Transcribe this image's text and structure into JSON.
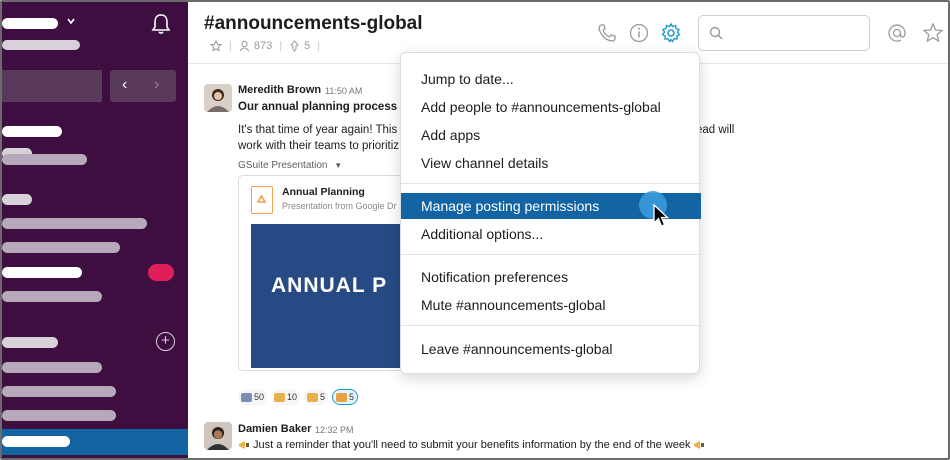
{
  "channel": {
    "name": "#announcements-global",
    "member_count": "873",
    "pinned_count": "5"
  },
  "search": {
    "placeholder": ""
  },
  "dropdown": {
    "items": [
      {
        "label": "Jump to date..."
      },
      {
        "label": "Add people to #announcements-global"
      },
      {
        "label": "Add apps"
      },
      {
        "label": "View channel details"
      },
      {
        "label": "Manage posting permissions",
        "highlighted": true
      },
      {
        "label": "Additional options..."
      },
      {
        "label": "Notification preferences"
      },
      {
        "label": "Mute #announcements-global"
      },
      {
        "label": "Leave #announcements-global"
      }
    ]
  },
  "messages": [
    {
      "author": "Meredith Brown",
      "time": "11:50 AM",
      "line1": "Our annual planning process will",
      "line2": "It's that time of year again! This w",
      "line2_right": "ead will",
      "line3": "work with their teams to prioritiz",
      "attachment": {
        "source_label": "GSuite Presentation",
        "title": "Annual Planning",
        "subtitle": "Presentation from Google Dr",
        "preview_text": "ANNUAL P"
      },
      "reactions": [
        {
          "count": "50",
          "color": "#7a8fb5",
          "selected": false
        },
        {
          "count": "10",
          "color": "#e8b04a",
          "selected": false
        },
        {
          "count": "5",
          "color": "#e8b04a",
          "selected": false
        },
        {
          "count": "5",
          "color": "#e8a040",
          "selected": true
        }
      ]
    },
    {
      "author": "Damien Baker",
      "time": "12:32 PM",
      "text": "Just a reminder that you'll need to submit your benefits information by the end of the week"
    }
  ],
  "colors": {
    "sidebar": "#3f0e40",
    "active_item": "#1264a3",
    "badge": "#e01e5a",
    "gear_accent": "#1d9bd1"
  }
}
